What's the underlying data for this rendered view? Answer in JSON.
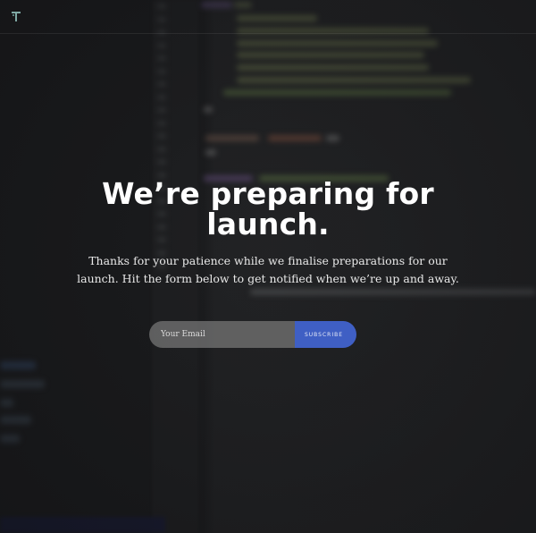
{
  "header": {
    "logo_name": "T-logo",
    "logo_color": "#7fa8a4"
  },
  "hero": {
    "headline": "We’re preparing for launch.",
    "subtext": "Thanks for your patience while we finalise preparations for our launch. Hit the form below to get notified when we’re up and away."
  },
  "form": {
    "email_placeholder": "Your Email",
    "subscribe_label": "SUBSCRIBE",
    "button_color": "#3f5fc4"
  }
}
